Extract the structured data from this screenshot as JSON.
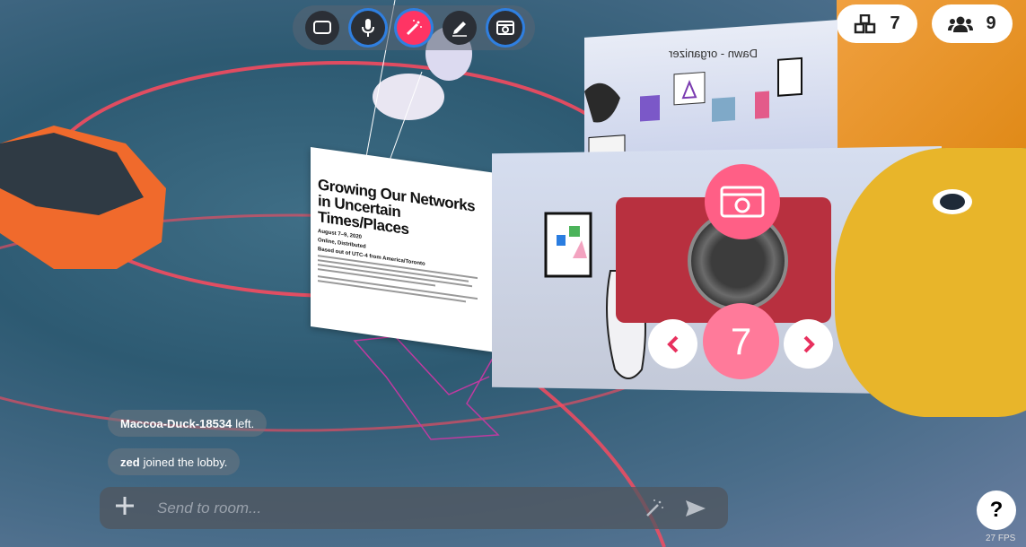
{
  "toolbar": {
    "buttons": [
      {
        "name": "screen-share-button",
        "icon": "screen-icon"
      },
      {
        "name": "microphone-button",
        "icon": "microphone-icon"
      },
      {
        "name": "magic-wand-button",
        "icon": "magic-wand-icon"
      },
      {
        "name": "pen-button",
        "icon": "pen-icon"
      },
      {
        "name": "camera-toggle-button",
        "icon": "camera-icon"
      }
    ]
  },
  "counters": {
    "objects": "7",
    "people": "9"
  },
  "webpage": {
    "title": "Growing Our Networks in Uncertain Times/Places",
    "date": "August 7–9, 2020",
    "location": "Online, Distributed",
    "based": "Based out of UTC-4 from America/Toronto"
  },
  "backscreen": {
    "text": "Dawn - organizer"
  },
  "camera": {
    "counter": "7"
  },
  "chat": {
    "messages": [
      {
        "user": "Maccoa-Duck-18534",
        "text": "left."
      },
      {
        "user": "zed",
        "text": "joined the lobby."
      }
    ],
    "placeholder": "Send to room..."
  },
  "help": {
    "label": "?"
  },
  "fps": {
    "label": "27 FPS"
  },
  "colors": {
    "accent_pink": "#ff3464",
    "ring_blue": "#2f7fe0",
    "camera_red": "#b8303f",
    "duck_yellow": "#e8b52a"
  }
}
